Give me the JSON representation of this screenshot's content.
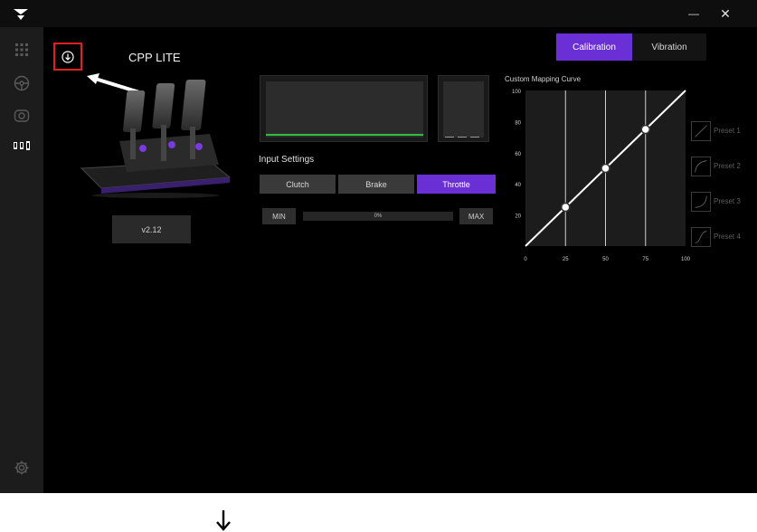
{
  "window": {
    "minimize_glyph": "—",
    "close_glyph": "✕"
  },
  "sidebar": {
    "icons": [
      "apps-grid-icon",
      "steering-wheel-icon",
      "dashboard-gauge-icon",
      "pedals-icon",
      "settings-gear-icon"
    ]
  },
  "device": {
    "name": "CPP LITE",
    "version": "v2.12",
    "download_icon": "download-icon"
  },
  "tabs": [
    {
      "label": "Calibration",
      "active": true
    },
    {
      "label": "Vibration",
      "active": false
    }
  ],
  "input_settings": {
    "title": "Input Settings",
    "pedals": [
      {
        "label": "Clutch",
        "active": false
      },
      {
        "label": "Brake",
        "active": false
      },
      {
        "label": "Throttle",
        "active": true
      }
    ],
    "min_label": "MIN",
    "max_label": "MAX",
    "range_text": "0%"
  },
  "mapping_curve": {
    "title": "Custom Mapping Curve",
    "y_ticks": [
      "100",
      "80",
      "60",
      "40",
      "20"
    ],
    "x_ticks": [
      "0",
      "25",
      "50",
      "75",
      "100"
    ],
    "points": [
      {
        "x": 0,
        "y": 0
      },
      {
        "x": 25,
        "y": 25
      },
      {
        "x": 50,
        "y": 50
      },
      {
        "x": 75,
        "y": 75
      },
      {
        "x": 100,
        "y": 100
      }
    ]
  },
  "presets": [
    "Preset 1",
    "Preset 2",
    "Preset 3",
    "Preset 4"
  ],
  "colors": {
    "accent": "#6b2fd6",
    "highlight": "#e5201c",
    "level": "#2fbf3f"
  }
}
